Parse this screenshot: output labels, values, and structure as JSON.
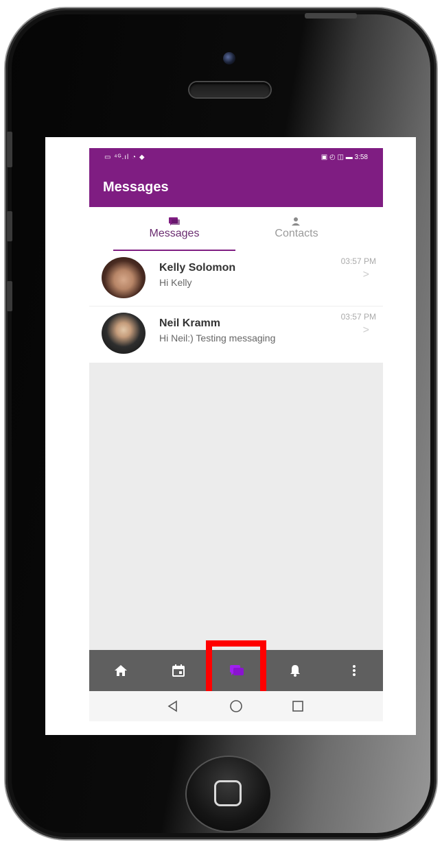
{
  "status_bar": {
    "left_icons": "▭ ⁴ᴳ.ıl ◔ ◆",
    "right_icons": "▣ ◴ ◫ ▬ 3:58"
  },
  "header": {
    "title": "Messages"
  },
  "tabs": [
    {
      "label": "Messages",
      "icon": "message-icon",
      "active": true
    },
    {
      "label": "Contacts",
      "icon": "person-icon",
      "active": false
    }
  ],
  "conversations": [
    {
      "name": "Kelly Solomon",
      "preview": "Hi Kelly",
      "time": "03:57 PM"
    },
    {
      "name": "Neil Kramm",
      "preview": "Hi Neil:) Testing messaging",
      "time": "03:57 PM"
    }
  ],
  "bottom_nav": [
    {
      "icon": "home-icon"
    },
    {
      "icon": "calendar-icon"
    },
    {
      "icon": "message-icon",
      "active": true
    },
    {
      "icon": "bell-icon"
    },
    {
      "icon": "more-icon"
    }
  ],
  "colors": {
    "brand": "#7f1d82",
    "active_nav_icon": "#a020f0",
    "highlight": "#ff0000",
    "bottom_nav_bg": "#5f5f5f"
  }
}
